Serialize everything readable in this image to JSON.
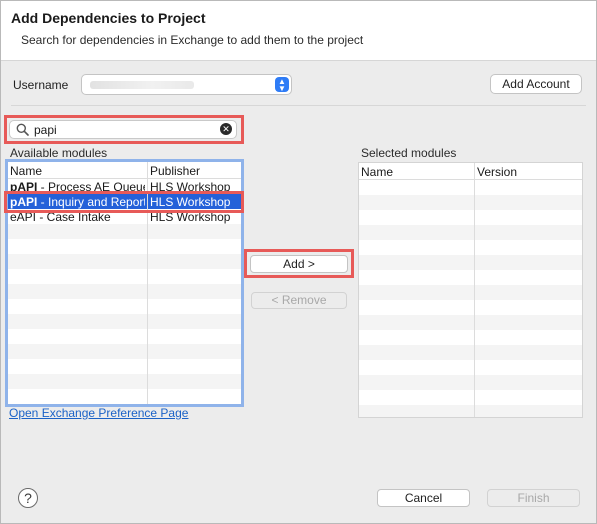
{
  "dialog": {
    "title": "Add Dependencies to Project",
    "subtitle": "Search for dependencies in Exchange to add them to the project"
  },
  "account": {
    "username_label": "Username",
    "username_value": "",
    "add_account_label": "Add Account"
  },
  "search": {
    "value": "papi",
    "icon": "search-icon",
    "clear_icon": "clear-icon"
  },
  "available": {
    "label": "Available modules",
    "columns": [
      "Name",
      "Publisher"
    ],
    "rows": [
      {
        "prefix": "pAPI",
        "name": " - Process AE Queue",
        "publisher": "HLS Workshop",
        "selected": false
      },
      {
        "prefix": "pAPI",
        "name": " - Inquiry and Report",
        "publisher": "HLS Workshop",
        "selected": true
      },
      {
        "prefix": "",
        "name": "eAPI - Case Intake",
        "publisher": "HLS Workshop",
        "selected": false
      }
    ]
  },
  "selected": {
    "label": "Selected modules",
    "columns": [
      "Name",
      "Version"
    ],
    "rows": []
  },
  "actions": {
    "add_label": "Add >",
    "remove_label": "< Remove"
  },
  "links": {
    "preference_page": "Open Exchange Preference Page"
  },
  "footer": {
    "help_label": "?",
    "cancel_label": "Cancel",
    "finish_label": "Finish"
  },
  "colors": {
    "highlight": "#e75a58",
    "selection": "#2461d9",
    "focus_ring": "#8fb3ea",
    "accent": "#2f7cf6",
    "link": "#1b62c7"
  }
}
